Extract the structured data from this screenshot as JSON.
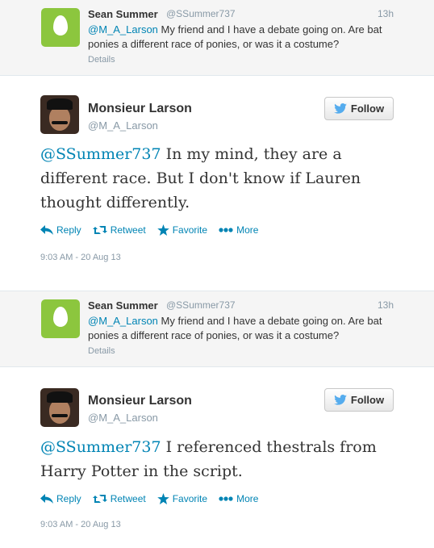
{
  "tweets": [
    {
      "parent": {
        "name": "Sean Summer",
        "handle": "@SSummer737",
        "time": "13h",
        "mention": "@M_A_Larson",
        "text": " My friend and I have a debate going on.  Are bat ponies a different race of ponies, or was it a costume?",
        "details": "Details"
      },
      "reply": {
        "name": "Monsieur Larson",
        "handle": "@M_A_Larson",
        "follow_label": "Follow",
        "mention": "@SSummer737",
        "text": " In my mind, they are a different race.  But I don't know if Lauren thought differently.",
        "timestamp": "9:03 AM - 20 Aug 13"
      }
    },
    {
      "parent": {
        "name": "Sean Summer",
        "handle": "@SSummer737",
        "time": "13h",
        "mention": "@M_A_Larson",
        "text": " My friend and I have a debate going on.  Are bat ponies a different race of ponies, or was it a costume?",
        "details": "Details"
      },
      "reply": {
        "name": "Monsieur Larson",
        "handle": "@M_A_Larson",
        "follow_label": "Follow",
        "mention": "@SSummer737",
        "text": "  I referenced thestrals from Harry Potter in the script.",
        "timestamp": "9:03 AM - 20 Aug 13"
      }
    }
  ],
  "actions": {
    "reply": "Reply",
    "retweet": "Retweet",
    "favorite": "Favorite",
    "more": "More"
  },
  "colors": {
    "link": "#0084b4",
    "muted": "#8899a6",
    "egg_green": "#8cc63e",
    "parent_bg": "#f5f5f5",
    "twitter_blue": "#55acee"
  },
  "icons": {
    "reply": "reply-arrow-icon",
    "retweet": "retweet-icon",
    "favorite": "star-icon",
    "more": "more-dots-icon",
    "follow": "twitter-bird-icon"
  }
}
